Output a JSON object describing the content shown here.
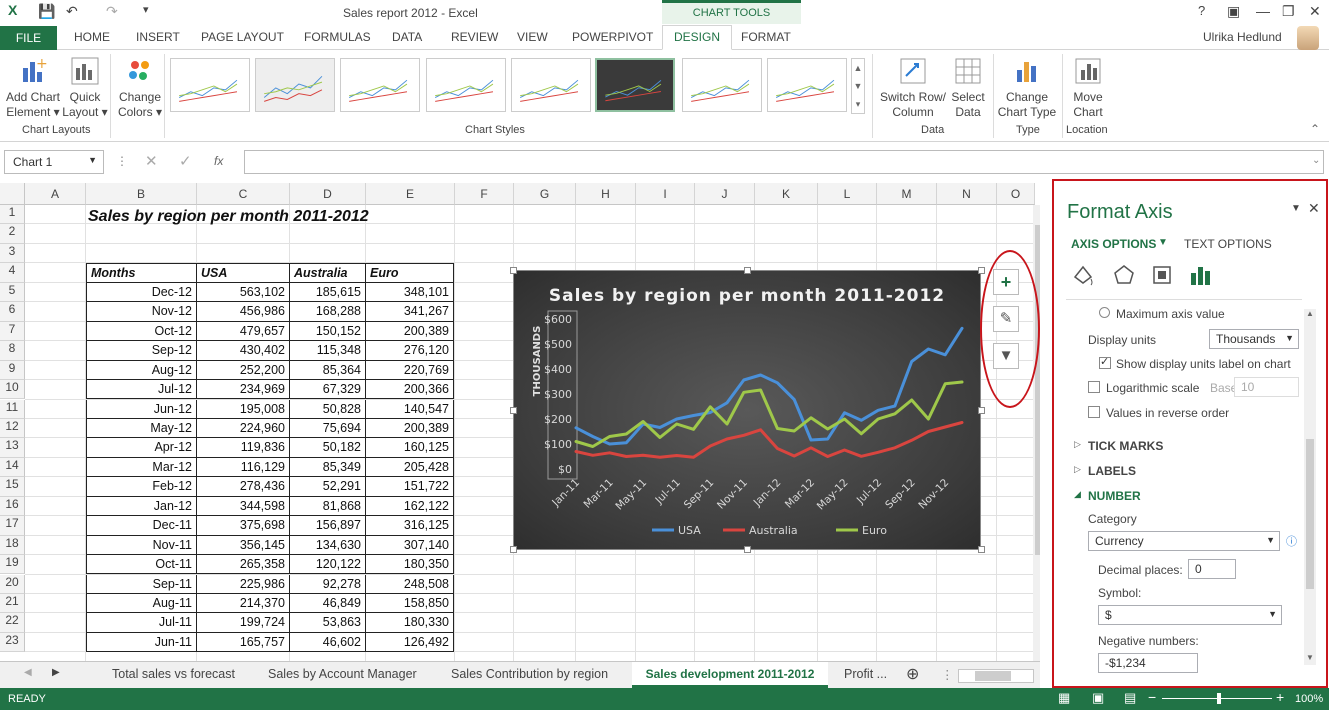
{
  "window": {
    "title": "Sales report 2012 - Excel",
    "context_tab": "CHART TOOLS",
    "help": "?",
    "user": "Ulrika Hedlund"
  },
  "tabs": [
    "FILE",
    "HOME",
    "INSERT",
    "PAGE LAYOUT",
    "FORMULAS",
    "DATA",
    "REVIEW",
    "VIEW",
    "POWERPIVOT",
    "DESIGN",
    "FORMAT"
  ],
  "ribbon": {
    "add_chart_element": "Add Chart Element",
    "quick_layout": "Quick Layout",
    "change_colors": "Change Colors",
    "group_chart_layouts": "Chart Layouts",
    "group_chart_styles": "Chart Styles",
    "switch_row_column": "Switch Row/ Column",
    "select_data": "Select Data",
    "group_data": "Data",
    "change_chart_type": "Change Chart Type",
    "group_type": "Type",
    "move_chart": "Move Chart",
    "group_location": "Location"
  },
  "formula_bar": {
    "name_box": "Chart 1",
    "fx": "fx",
    "value": ""
  },
  "columns": [
    "A",
    "B",
    "C",
    "D",
    "E",
    "F",
    "G",
    "H",
    "I",
    "J",
    "K",
    "L",
    "M",
    "N",
    "O"
  ],
  "rows": [
    "1",
    "2",
    "3",
    "4",
    "5",
    "6",
    "7",
    "8",
    "9",
    "10",
    "11",
    "12",
    "13",
    "14",
    "15",
    "16",
    "17",
    "18",
    "19",
    "20",
    "21",
    "22",
    "23"
  ],
  "sheet": {
    "title": "Sales by region per month 2011-2012",
    "headers": [
      "Months",
      "USA",
      "Australia",
      "Euro"
    ],
    "data": [
      [
        "Dec-12",
        "563,102",
        "185,615",
        "348,101"
      ],
      [
        "Nov-12",
        "456,986",
        "168,288",
        "341,267"
      ],
      [
        "Oct-12",
        "479,657",
        "150,152",
        "200,389"
      ],
      [
        "Sep-12",
        "430,402",
        "115,348",
        "276,120"
      ],
      [
        "Aug-12",
        "252,200",
        "85,364",
        "220,769"
      ],
      [
        "Jul-12",
        "234,969",
        "67,329",
        "200,366"
      ],
      [
        "Jun-12",
        "195,008",
        "50,828",
        "140,547"
      ],
      [
        "May-12",
        "224,960",
        "75,694",
        "200,389"
      ],
      [
        "Apr-12",
        "119,836",
        "50,182",
        "160,125"
      ],
      [
        "Mar-12",
        "116,129",
        "85,349",
        "205,428"
      ],
      [
        "Feb-12",
        "278,436",
        "52,291",
        "151,722"
      ],
      [
        "Jan-12",
        "344,598",
        "81,868",
        "162,122"
      ],
      [
        "Dec-11",
        "375,698",
        "156,897",
        "316,125"
      ],
      [
        "Nov-11",
        "356,145",
        "134,630",
        "307,140"
      ],
      [
        "Oct-11",
        "265,358",
        "120,122",
        "180,350"
      ],
      [
        "Sep-11",
        "225,986",
        "92,278",
        "248,508"
      ],
      [
        "Aug-11",
        "214,370",
        "46,849",
        "158,850"
      ],
      [
        "Jul-11",
        "199,724",
        "53,863",
        "180,330"
      ],
      [
        "Jun-11",
        "165,757",
        "46,602",
        "126,492"
      ]
    ]
  },
  "chart_data": {
    "type": "line",
    "title": "Sales by region per month 2011-2012",
    "ylabel": "THOUSANDS",
    "y_ticks": [
      "$0",
      "$100",
      "$200",
      "$300",
      "$400",
      "$500",
      "$600"
    ],
    "ylim": [
      0,
      600
    ],
    "x_ticks": [
      "Jan-11",
      "Mar-11",
      "May-11",
      "Jul-11",
      "Sep-11",
      "Nov-11",
      "Jan-12",
      "Mar-12",
      "May-12",
      "Jul-12",
      "Sep-12",
      "Nov-12"
    ],
    "x": [
      "Jan-11",
      "Feb-11",
      "Mar-11",
      "Apr-11",
      "May-11",
      "Jun-11",
      "Jul-11",
      "Aug-11",
      "Sep-11",
      "Oct-11",
      "Nov-11",
      "Dec-11",
      "Jan-12",
      "Feb-12",
      "Mar-12",
      "Apr-12",
      "May-12",
      "Jun-12",
      "Jul-12",
      "Aug-12",
      "Sep-12",
      "Oct-12",
      "Nov-12",
      "Dec-12"
    ],
    "series": [
      {
        "name": "USA",
        "color": "#4a90d9",
        "values": [
          165,
          130,
          100,
          105,
          180,
          166,
          200,
          214,
          226,
          265,
          356,
          376,
          345,
          278,
          116,
          120,
          225,
          195,
          235,
          252,
          430,
          480,
          457,
          563
        ]
      },
      {
        "name": "Australia",
        "color": "#d9453f",
        "values": [
          70,
          55,
          65,
          50,
          55,
          47,
          54,
          47,
          92,
          120,
          135,
          157,
          82,
          52,
          85,
          50,
          76,
          51,
          67,
          85,
          115,
          150,
          168,
          186
        ]
      },
      {
        "name": "Euro",
        "color": "#9fc84a",
        "values": [
          110,
          90,
          130,
          140,
          190,
          126,
          180,
          159,
          249,
          180,
          307,
          316,
          162,
          152,
          205,
          160,
          200,
          141,
          200,
          221,
          276,
          200,
          341,
          348
        ]
      }
    ],
    "legend": "bottom",
    "grid": false
  },
  "sheet_tabs": [
    "Total sales vs forecast",
    "Sales by Account Manager",
    "Sales Contribution by region",
    "Sales development 2011-2012",
    "Profit ..."
  ],
  "status": {
    "mode": "READY",
    "zoom": "100%"
  },
  "pane": {
    "title": "Format Axis",
    "tab_axis": "AXIS OPTIONS",
    "tab_text": "TEXT OPTIONS",
    "max_axis_value": "Maximum axis value",
    "display_units_label": "Display units",
    "display_units_value": "Thousands",
    "show_units_label": "Show display units label on chart",
    "log_scale": "Logarithmic scale",
    "base_label": "Base",
    "base_value": "10",
    "reverse_order": "Values in reverse order",
    "tick_marks": "TICK MARKS",
    "labels": "LABELS",
    "number": "NUMBER",
    "category_label": "Category",
    "category_value": "Currency",
    "decimal_label": "Decimal places:",
    "decimal_value": "0",
    "symbol_label": "Symbol:",
    "symbol_value": "$",
    "negative_label": "Negative numbers:",
    "negative_value": "-$1,234"
  }
}
